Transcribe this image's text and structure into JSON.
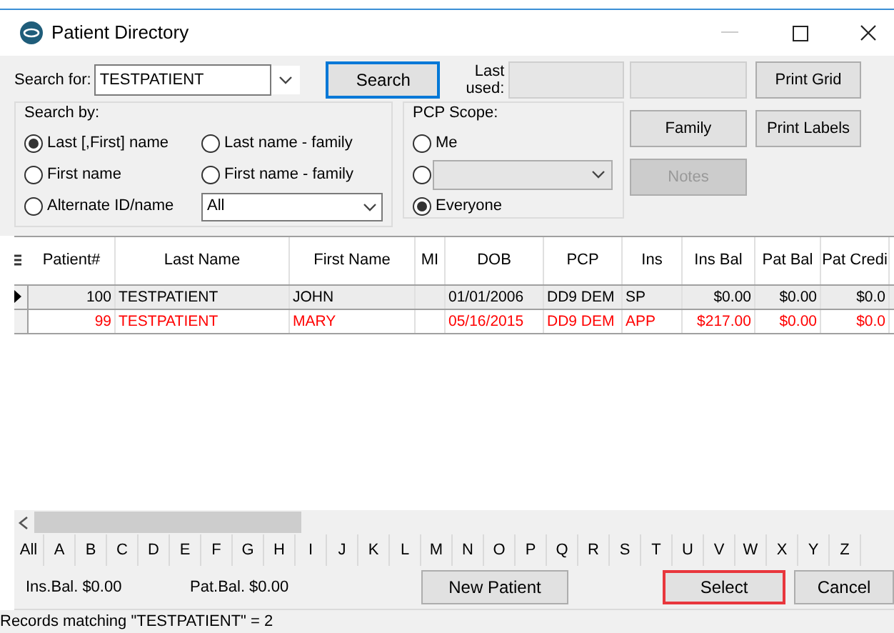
{
  "window": {
    "title": "Patient Directory"
  },
  "search": {
    "label": "Search for:",
    "value": "TESTPATIENT",
    "button": "Search"
  },
  "last_used": {
    "label": "Last used:"
  },
  "buttons_right": [
    {
      "label": "Print Grid",
      "disabled": false
    },
    {
      "label": "Family",
      "disabled": false
    },
    {
      "label": "Print Labels",
      "disabled": false
    },
    {
      "label": "Notes",
      "disabled": true
    }
  ],
  "search_by": {
    "title": "Search by:",
    "options": [
      {
        "label": "Last [,First] name",
        "selected": true
      },
      {
        "label": "Last name - family",
        "selected": false
      },
      {
        "label": "First name",
        "selected": false
      },
      {
        "label": "First name - family",
        "selected": false
      },
      {
        "label": "Alternate ID/name",
        "selected": false
      }
    ],
    "filter_value": "All"
  },
  "pcp_scope": {
    "title": "PCP Scope:",
    "options": [
      {
        "kind": "text",
        "label": "Me",
        "selected": false
      },
      {
        "kind": "dropdown",
        "selected": false
      },
      {
        "kind": "text",
        "label": "Everyone",
        "selected": true
      }
    ]
  },
  "table": {
    "columns": [
      "Patient#",
      "Last Name",
      "First Name",
      "MI",
      "DOB",
      "PCP",
      "Ins",
      "Ins Bal",
      "Pat Bal",
      "Pat Credi"
    ],
    "rows": [
      {
        "selected": true,
        "color": "#000000",
        "cells": [
          "100",
          "TESTPATIENT",
          "JOHN",
          "",
          "01/01/2006",
          "DD9 DEM",
          "SP",
          "$0.00",
          "$0.00",
          "$0.0"
        ]
      },
      {
        "selected": false,
        "color": "#ff0000",
        "cells": [
          "99",
          "TESTPATIENT",
          "MARY",
          "",
          "05/16/2015",
          "DD9 DEM",
          "APP",
          "$217.00",
          "$0.00",
          "$0.0"
        ]
      }
    ]
  },
  "alphabet": [
    "All",
    "A",
    "B",
    "C",
    "D",
    "E",
    "F",
    "G",
    "H",
    "I",
    "J",
    "K",
    "L",
    "M",
    "N",
    "O",
    "P",
    "Q",
    "R",
    "S",
    "T",
    "U",
    "V",
    "W",
    "X",
    "Y",
    "Z"
  ],
  "balances": [
    {
      "label": "Ins.Bal.",
      "value": "$0.00"
    },
    {
      "label": "Pat.Bal.",
      "value": "$0.00"
    }
  ],
  "actions": [
    {
      "label": "New Patient",
      "highlighted": false
    },
    {
      "label": "Select",
      "highlighted": true
    },
    {
      "label": "Cancel",
      "highlighted": false
    }
  ],
  "status_bar": "Records matching \"TESTPATIENT\" = 2"
}
